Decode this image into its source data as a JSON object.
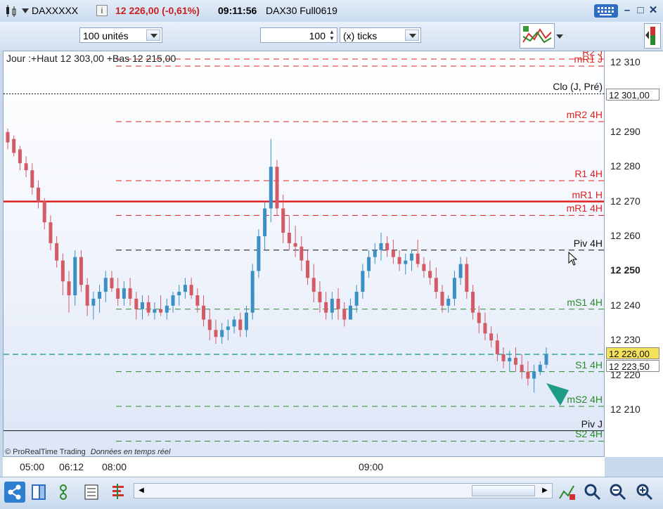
{
  "window": {
    "instrument": "DAXXXXX",
    "price_change": "12 226,00 (-0,61%)",
    "time": "09:11:56",
    "contract": "DAX30 Full0619"
  },
  "toolbar": {
    "units_value": "100 unités",
    "ticks_value": "100",
    "ticks_unit": "(x) ticks"
  },
  "chart": {
    "info_line": "Jour :+Haut 12 303,00 +Bas 12 215,00",
    "copyright": "© ProRealTime Trading",
    "realtime": "Données en temps réel",
    "current_price_label": "12 226,00",
    "cursor_price_label": "12 223,50",
    "clo_price_label": "12 301,00"
  },
  "colors": {
    "up": "#3b8fc4",
    "down": "#d45a66",
    "resistance": "#e02020",
    "support": "#2a8a2a",
    "pivot": "#111111",
    "current": "#2aa39a"
  },
  "chart_data": {
    "type": "candlestick",
    "x_ticks": [
      "05:00",
      "06:12",
      "08:00",
      "09:00"
    ],
    "y_ticks": [
      "12 310",
      "12 290",
      "12 280",
      "12 270",
      "12 260",
      "12 250",
      "12 240",
      "12 230",
      "12 220",
      "12 210"
    ],
    "ylim": [
      12200,
      12316
    ],
    "levels": [
      {
        "label": "R2 J",
        "value": 12311,
        "color": "#e02020",
        "style": "dash"
      },
      {
        "label": "mR1 J",
        "value": 12309,
        "color": "#e02020",
        "style": "dash"
      },
      {
        "label": "Clo (J, Pré)",
        "value": 12301,
        "color": "#111111",
        "style": "dot"
      },
      {
        "label": "mR2 4H",
        "value": 12293,
        "color": "#e02020",
        "style": "dash"
      },
      {
        "label": "R1 4H",
        "value": 12276,
        "color": "#e02020",
        "style": "dash"
      },
      {
        "label": "mR1 H",
        "value": 12270,
        "color": "#e02020",
        "style": "solid"
      },
      {
        "label": "mR1 4H",
        "value": 12266,
        "color": "#e02020",
        "style": "dash"
      },
      {
        "label": "Piv 4H",
        "value": 12256,
        "color": "#111111",
        "style": "dash"
      },
      {
        "label": "mS1 4H",
        "value": 12239,
        "color": "#2a8a2a",
        "style": "dash"
      },
      {
        "label": "S1 4H",
        "value": 12221,
        "color": "#2a8a2a",
        "style": "dash"
      },
      {
        "label": "mS2 4H",
        "value": 12211,
        "color": "#2a8a2a",
        "style": "dash"
      },
      {
        "label": "Piv J",
        "value": 12204,
        "color": "#111111",
        "style": "solid"
      },
      {
        "label": "S2 4H",
        "value": 12201,
        "color": "#2a8a2a",
        "style": "dash"
      }
    ],
    "current_price": 12226,
    "candles": [
      [
        12290,
        12291,
        12285,
        12287
      ],
      [
        12288,
        12289,
        12283,
        12284
      ],
      [
        12285,
        12286,
        12279,
        12281
      ],
      [
        12281,
        12283,
        12277,
        12279
      ],
      [
        12279,
        12281,
        12272,
        12274
      ],
      [
        12274,
        12276,
        12268,
        12270
      ],
      [
        12270,
        12271,
        12262,
        12264
      ],
      [
        12264,
        12266,
        12256,
        12258
      ],
      [
        12258,
        12260,
        12251,
        12253
      ],
      [
        12253,
        12255,
        12243,
        12247
      ],
      [
        12247,
        12250,
        12238,
        12243
      ],
      [
        12243,
        12256,
        12240,
        12254
      ],
      [
        12254,
        12256,
        12244,
        12246
      ],
      [
        12246,
        12248,
        12237,
        12240
      ],
      [
        12240,
        12244,
        12236,
        12242
      ],
      [
        12242,
        12246,
        12238,
        12244
      ],
      [
        12244,
        12250,
        12241,
        12248
      ],
      [
        12248,
        12250,
        12244,
        12245
      ],
      [
        12245,
        12248,
        12240,
        12242
      ],
      [
        12242,
        12247,
        12240,
        12245
      ],
      [
        12245,
        12248,
        12240,
        12242
      ],
      [
        12242,
        12244,
        12236,
        12239
      ],
      [
        12239,
        12243,
        12236,
        12241
      ],
      [
        12241,
        12243,
        12237,
        12238
      ],
      [
        12238,
        12241,
        12236,
        12239
      ],
      [
        12239,
        12243,
        12237,
        12238
      ],
      [
        12238,
        12242,
        12236,
        12240
      ],
      [
        12240,
        12244,
        12238,
        12243
      ],
      [
        12243,
        12246,
        12240,
        12244
      ],
      [
        12244,
        12248,
        12242,
        12246
      ],
      [
        12246,
        12248,
        12242,
        12243
      ],
      [
        12243,
        12245,
        12238,
        12240
      ],
      [
        12240,
        12243,
        12234,
        12236
      ],
      [
        12236,
        12239,
        12230,
        12233
      ],
      [
        12233,
        12236,
        12229,
        12231
      ],
      [
        12231,
        12235,
        12229,
        12233
      ],
      [
        12233,
        12236,
        12230,
        12234
      ],
      [
        12234,
        12237,
        12232,
        12236
      ],
      [
        12236,
        12238,
        12231,
        12233
      ],
      [
        12233,
        12240,
        12231,
        12238
      ],
      [
        12238,
        12252,
        12236,
        12250
      ],
      [
        12250,
        12262,
        12248,
        12260
      ],
      [
        12260,
        12270,
        12256,
        12268
      ],
      [
        12268,
        12288,
        12264,
        12280
      ],
      [
        12280,
        12282,
        12266,
        12268
      ],
      [
        12268,
        12272,
        12258,
        12261
      ],
      [
        12261,
        12266,
        12256,
        12258
      ],
      [
        12258,
        12263,
        12254,
        12257
      ],
      [
        12257,
        12260,
        12250,
        12253
      ],
      [
        12253,
        12256,
        12246,
        12248
      ],
      [
        12248,
        12252,
        12241,
        12244
      ],
      [
        12244,
        12247,
        12238,
        12241
      ],
      [
        12241,
        12244,
        12236,
        12238
      ],
      [
        12238,
        12244,
        12236,
        12242
      ],
      [
        12242,
        12245,
        12236,
        12239
      ],
      [
        12239,
        12241,
        12234,
        12236
      ],
      [
        12236,
        12242,
        12236,
        12240
      ],
      [
        12240,
        12246,
        12238,
        12244
      ],
      [
        12244,
        12252,
        12242,
        12250
      ],
      [
        12250,
        12256,
        12248,
        12254
      ],
      [
        12254,
        12258,
        12252,
        12256
      ],
      [
        12256,
        12261,
        12253,
        12258
      ],
      [
        12258,
        12260,
        12254,
        12256
      ],
      [
        12256,
        12259,
        12252,
        12254
      ],
      [
        12254,
        12256,
        12250,
        12252
      ],
      [
        12252,
        12255,
        12249,
        12253
      ],
      [
        12253,
        12256,
        12250,
        12255
      ],
      [
        12255,
        12259,
        12251,
        12252
      ],
      [
        12252,
        12254,
        12248,
        12250
      ],
      [
        12250,
        12253,
        12246,
        12248
      ],
      [
        12248,
        12251,
        12242,
        12244
      ],
      [
        12244,
        12246,
        12238,
        12240
      ],
      [
        12240,
        12243,
        12238,
        12242
      ],
      [
        12242,
        12250,
        12240,
        12248
      ],
      [
        12248,
        12254,
        12246,
        12252
      ],
      [
        12252,
        12254,
        12242,
        12244
      ],
      [
        12244,
        12246,
        12236,
        12238
      ],
      [
        12238,
        12240,
        12232,
        12235
      ],
      [
        12235,
        12238,
        12230,
        12232
      ],
      [
        12232,
        12234,
        12228,
        12230
      ],
      [
        12230,
        12232,
        12224,
        12226
      ],
      [
        12226,
        12228,
        12222,
        12224
      ],
      [
        12224,
        12227,
        12221,
        12225
      ],
      [
        12225,
        12228,
        12221,
        12223
      ],
      [
        12223,
        12226,
        12219,
        12221
      ],
      [
        12221,
        12224,
        12217,
        12219
      ],
      [
        12219,
        12223,
        12215,
        12221
      ],
      [
        12221,
        12224,
        12220,
        12223
      ],
      [
        12223,
        12228,
        12222,
        12226
      ]
    ]
  }
}
